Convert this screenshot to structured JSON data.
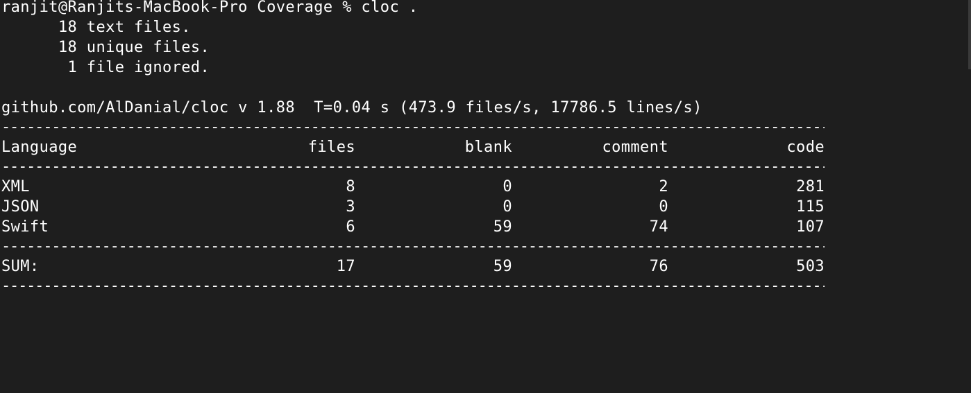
{
  "terminal": {
    "prompt_line": "ranjit@Ranjits-MacBook-Pro Coverage % cloc .",
    "summary_lines": [
      "      18 text files.",
      "      18 unique files.",
      "       1 file ignored."
    ],
    "version_line": "github.com/AlDanial/cloc v 1.88  T=0.04 s (473.9 files/s, 17786.5 lines/s)",
    "divider": "-------------------------------------------------------------------------------------------------------------------------------------------------------------------------------------------------------------------",
    "headers": [
      "Language",
      "files",
      "blank",
      "comment",
      "code"
    ],
    "rows": [
      {
        "language": "XML",
        "files": "8",
        "blank": "0",
        "comment": "2",
        "code": "281"
      },
      {
        "language": "JSON",
        "files": "3",
        "blank": "0",
        "comment": "0",
        "code": "115"
      },
      {
        "language": "Swift",
        "files": "6",
        "blank": "59",
        "comment": "74",
        "code": "107"
      }
    ],
    "sum": {
      "label": "SUM:",
      "files": "17",
      "blank": "59",
      "comment": "76",
      "code": "503"
    }
  }
}
